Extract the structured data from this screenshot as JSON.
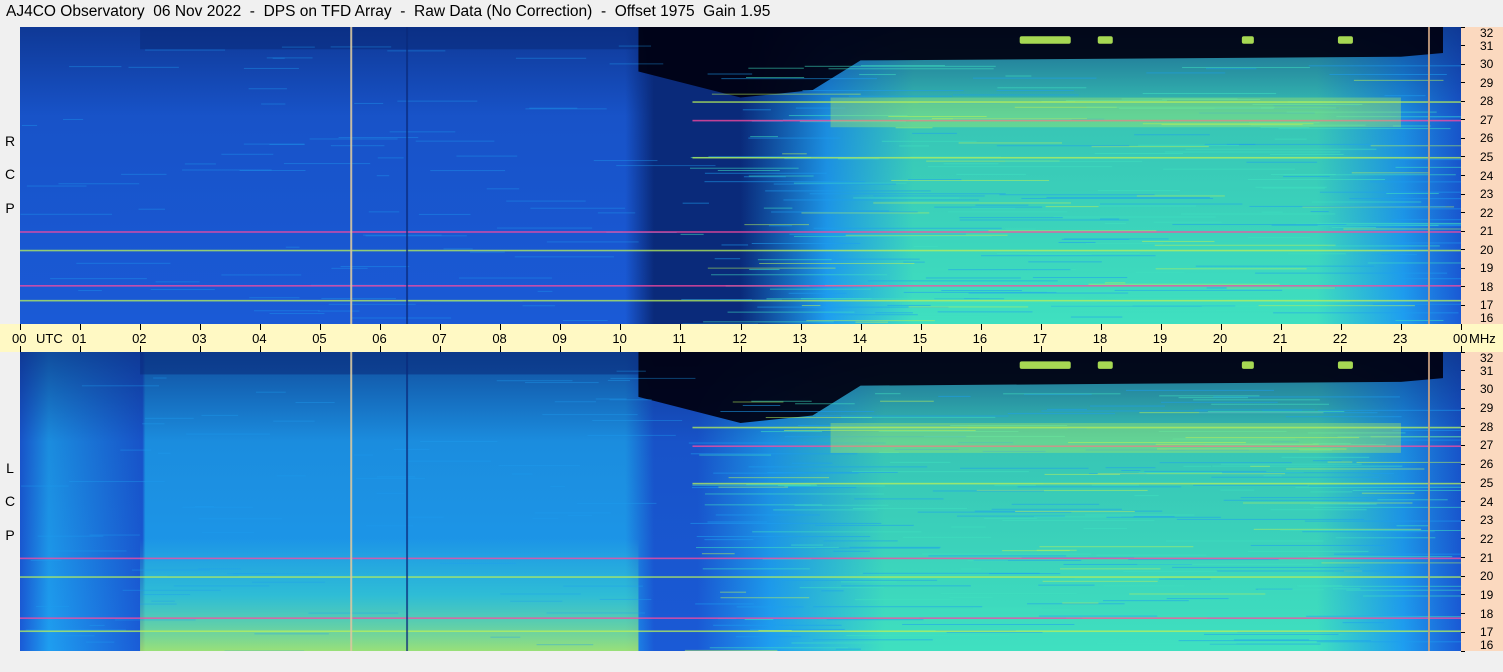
{
  "title": "AJ4CO Observatory  06 Nov 2022  -  DPS on TFD Array  -  Raw Data (No Correction)  -  Offset 1975  Gain 1.95",
  "chart_data": [
    {
      "type": "heatmap",
      "panel": "RCP",
      "side_label": [
        "R",
        "C",
        "P"
      ],
      "x_axis": {
        "label": "UTC",
        "range": [
          0,
          24
        ],
        "ticks": [
          "00",
          "01",
          "02",
          "03",
          "04",
          "05",
          "06",
          "07",
          "08",
          "09",
          "10",
          "11",
          "12",
          "13",
          "14",
          "15",
          "16",
          "17",
          "18",
          "19",
          "20",
          "21",
          "22",
          "23",
          "00"
        ]
      },
      "y_axis": {
        "label": "MHz",
        "range": [
          16,
          32
        ],
        "ticks": [
          16,
          17,
          18,
          19,
          20,
          21,
          22,
          23,
          24,
          25,
          26,
          27,
          28,
          29,
          30,
          31,
          32
        ]
      },
      "colormap": [
        "#000010",
        "#0a2a7a",
        "#1a5ad6",
        "#1e9ef0",
        "#3fe0c0",
        "#b8f05a",
        "#ff4aa0"
      ],
      "features": {
        "vertical_lines_utc": [
          5.5,
          23.45
        ],
        "interference_mhz": [
          17.3,
          18.1,
          20.0,
          21.0,
          25.0,
          27.0,
          28.0
        ],
        "dark_region_utc": [
          10.3,
          13.0
        ],
        "bursts_at_31mhz_utc": [
          [
            16.65,
            17.5
          ],
          [
            17.95,
            18.2
          ],
          [
            20.35,
            20.55
          ],
          [
            21.95,
            22.2
          ]
        ]
      }
    },
    {
      "type": "heatmap",
      "panel": "LCP",
      "side_label": [
        "L",
        "C",
        "P"
      ],
      "x_axis": {
        "label": "UTC",
        "range": [
          0,
          24
        ]
      },
      "y_axis": {
        "label": "MHz",
        "range": [
          16,
          32
        ],
        "ticks": [
          16,
          17,
          18,
          19,
          20,
          21,
          22,
          23,
          24,
          25,
          26,
          27,
          28,
          29,
          30,
          31,
          32
        ]
      },
      "colormap": [
        "#000010",
        "#0a2a7a",
        "#1a5ad6",
        "#1e9ef0",
        "#3fe0c0",
        "#b8f05a",
        "#ff4aa0"
      ],
      "features": {
        "vertical_lines_utc": [
          5.5,
          23.45
        ],
        "interference_mhz": [
          17.1,
          17.8,
          20.0,
          21.0,
          25.0,
          27.0,
          28.0
        ],
        "bright_band_utc": [
          2.0,
          10.3
        ],
        "bursts_at_31mhz_utc": [
          [
            16.65,
            17.5
          ],
          [
            17.95,
            18.2
          ],
          [
            20.35,
            20.55
          ],
          [
            21.95,
            22.2
          ]
        ]
      }
    }
  ],
  "time_axis": {
    "utc_label": "UTC",
    "unit_label": "MHz",
    "hour_labels": [
      "00",
      "01",
      "02",
      "03",
      "04",
      "05",
      "06",
      "07",
      "08",
      "09",
      "10",
      "11",
      "12",
      "13",
      "14",
      "15",
      "16",
      "17",
      "18",
      "19",
      "20",
      "21",
      "22",
      "23",
      "00"
    ]
  }
}
